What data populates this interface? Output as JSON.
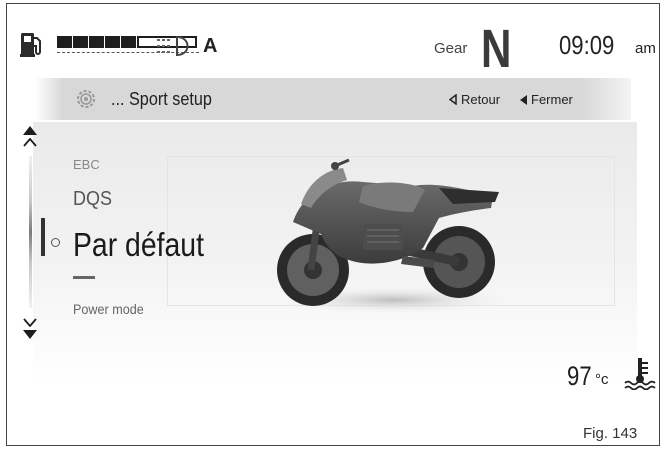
{
  "status": {
    "gear_label": "Gear",
    "gear_value": "N",
    "time": "09:09",
    "am_pm": "am",
    "auto_light": "A",
    "fuel_level_segments_filled": 5,
    "fuel_level_segments_total": 9
  },
  "menu_bar": {
    "title": "... Sport setup",
    "back_label": "Retour",
    "close_label": "Fermer",
    "icon": "gear-icon"
  },
  "menu": {
    "items": [
      {
        "label": "EBC",
        "state": "dim"
      },
      {
        "label": "DQS",
        "state": "normal"
      },
      {
        "label": "Par défaut",
        "state": "selected"
      },
      {
        "label": "—",
        "state": "placeholder"
      },
      {
        "label": "Power mode",
        "state": "dim"
      }
    ]
  },
  "temperature": {
    "value": "97",
    "unit": "°c",
    "icon": "coolant-temperature-icon"
  },
  "figure_caption": "Fig. 143",
  "colors": {
    "text_dark": "#1e1e1e",
    "panel_grey": "#d8d8d8",
    "dim_text": "#888888"
  }
}
